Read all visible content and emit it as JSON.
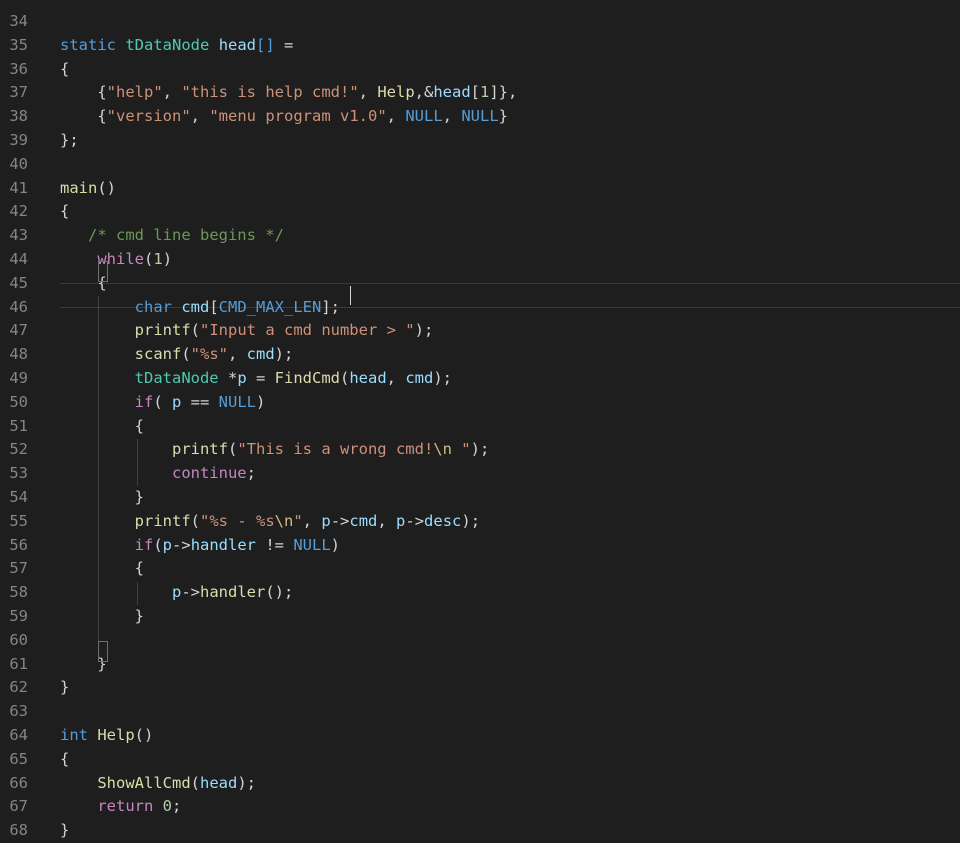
{
  "editor": {
    "theme_colors": {
      "background": "#1e1e1e",
      "line_number": "#858585",
      "keyword": "#569cd6",
      "control": "#c586c0",
      "type": "#4ec9b0",
      "variable": "#9cdcfe",
      "function": "#dcdcaa",
      "string": "#ce9178",
      "number": "#b5cea8",
      "comment": "#6a9955"
    },
    "lines": [
      {
        "n": "34",
        "tokens": []
      },
      {
        "n": "35",
        "tokens": [
          [
            "kw",
            "static"
          ],
          [
            "plain",
            " "
          ],
          [
            "type",
            "tDataNode"
          ],
          [
            "plain",
            " "
          ],
          [
            "var",
            "head"
          ],
          [
            "kw",
            "[]"
          ],
          [
            "plain",
            " ="
          ]
        ]
      },
      {
        "n": "36",
        "tokens": [
          [
            "pun",
            "{"
          ]
        ]
      },
      {
        "n": "37",
        "tokens": [
          [
            "plain",
            "    "
          ],
          [
            "pun",
            "{"
          ],
          [
            "str",
            "\"help\""
          ],
          [
            "pun",
            ", "
          ],
          [
            "str",
            "\"this is help cmd!\""
          ],
          [
            "pun",
            ", "
          ],
          [
            "fn",
            "Help"
          ],
          [
            "pun",
            ",&"
          ],
          [
            "var",
            "head"
          ],
          [
            "pun",
            "["
          ],
          [
            "num",
            "1"
          ],
          [
            "pun",
            "]},"
          ]
        ]
      },
      {
        "n": "38",
        "tokens": [
          [
            "plain",
            "    "
          ],
          [
            "pun",
            "{"
          ],
          [
            "str",
            "\"version\""
          ],
          [
            "pun",
            ", "
          ],
          [
            "str",
            "\"menu program v1.0\""
          ],
          [
            "pun",
            ", "
          ],
          [
            "mac",
            "NULL"
          ],
          [
            "pun",
            ", "
          ],
          [
            "mac",
            "NULL"
          ],
          [
            "pun",
            "}"
          ]
        ]
      },
      {
        "n": "39",
        "tokens": [
          [
            "pun",
            "};"
          ]
        ]
      },
      {
        "n": "40",
        "tokens": []
      },
      {
        "n": "41",
        "tokens": [
          [
            "fn",
            "main"
          ],
          [
            "pun",
            "()"
          ]
        ]
      },
      {
        "n": "42",
        "tokens": [
          [
            "pun",
            "{"
          ]
        ]
      },
      {
        "n": "43",
        "tokens": [
          [
            "plain",
            "   "
          ],
          [
            "com",
            "/* cmd line begins */"
          ]
        ]
      },
      {
        "n": "44",
        "tokens": [
          [
            "plain",
            "    "
          ],
          [
            "ctl",
            "while"
          ],
          [
            "pun",
            "("
          ],
          [
            "num",
            "1"
          ],
          [
            "pun",
            ")"
          ]
        ]
      },
      {
        "n": "45",
        "tokens": [
          [
            "plain",
            "    "
          ],
          [
            "pun",
            "{"
          ]
        ]
      },
      {
        "n": "46",
        "tokens": [
          [
            "plain",
            "        "
          ],
          [
            "kw",
            "char"
          ],
          [
            "plain",
            " "
          ],
          [
            "var",
            "cmd"
          ],
          [
            "pun",
            "["
          ],
          [
            "mac",
            "CMD_MAX_LEN"
          ],
          [
            "pun",
            "];"
          ]
        ]
      },
      {
        "n": "47",
        "tokens": [
          [
            "plain",
            "        "
          ],
          [
            "fn",
            "printf"
          ],
          [
            "pun",
            "("
          ],
          [
            "str",
            "\"Input a cmd number > \""
          ],
          [
            "pun",
            ");"
          ]
        ]
      },
      {
        "n": "48",
        "tokens": [
          [
            "plain",
            "        "
          ],
          [
            "fn",
            "scanf"
          ],
          [
            "pun",
            "("
          ],
          [
            "str",
            "\"%s\""
          ],
          [
            "pun",
            ", "
          ],
          [
            "var",
            "cmd"
          ],
          [
            "pun",
            ");"
          ]
        ]
      },
      {
        "n": "49",
        "tokens": [
          [
            "plain",
            "        "
          ],
          [
            "type",
            "tDataNode"
          ],
          [
            "plain",
            " *"
          ],
          [
            "var",
            "p"
          ],
          [
            "plain",
            " = "
          ],
          [
            "fn",
            "FindCmd"
          ],
          [
            "pun",
            "("
          ],
          [
            "var",
            "head"
          ],
          [
            "pun",
            ", "
          ],
          [
            "var",
            "cmd"
          ],
          [
            "pun",
            ");"
          ]
        ]
      },
      {
        "n": "50",
        "tokens": [
          [
            "plain",
            "        "
          ],
          [
            "ctl",
            "if"
          ],
          [
            "pun",
            "( "
          ],
          [
            "var",
            "p"
          ],
          [
            "plain",
            " == "
          ],
          [
            "mac",
            "NULL"
          ],
          [
            "pun",
            ")"
          ]
        ]
      },
      {
        "n": "51",
        "tokens": [
          [
            "plain",
            "        "
          ],
          [
            "pun",
            "{"
          ]
        ]
      },
      {
        "n": "52",
        "tokens": [
          [
            "plain",
            "            "
          ],
          [
            "fn",
            "printf"
          ],
          [
            "pun",
            "("
          ],
          [
            "str",
            "\"This is a wrong cmd!"
          ],
          [
            "esc",
            "\\n"
          ],
          [
            "str",
            " \""
          ],
          [
            "pun",
            ");"
          ]
        ]
      },
      {
        "n": "53",
        "tokens": [
          [
            "plain",
            "            "
          ],
          [
            "ctl",
            "continue"
          ],
          [
            "pun",
            ";"
          ]
        ]
      },
      {
        "n": "54",
        "tokens": [
          [
            "plain",
            "        "
          ],
          [
            "pun",
            "}"
          ]
        ]
      },
      {
        "n": "55",
        "tokens": [
          [
            "plain",
            "        "
          ],
          [
            "fn",
            "printf"
          ],
          [
            "pun",
            "("
          ],
          [
            "str",
            "\"%s - %s"
          ],
          [
            "esc",
            "\\n"
          ],
          [
            "str",
            "\""
          ],
          [
            "pun",
            ", "
          ],
          [
            "var",
            "p"
          ],
          [
            "pun",
            "->"
          ],
          [
            "var",
            "cmd"
          ],
          [
            "pun",
            ", "
          ],
          [
            "var",
            "p"
          ],
          [
            "pun",
            "->"
          ],
          [
            "var",
            "desc"
          ],
          [
            "pun",
            ");"
          ]
        ]
      },
      {
        "n": "56",
        "tokens": [
          [
            "plain",
            "        "
          ],
          [
            "ctl",
            "if"
          ],
          [
            "pun",
            "("
          ],
          [
            "var",
            "p"
          ],
          [
            "pun",
            "->"
          ],
          [
            "var",
            "handler"
          ],
          [
            "plain",
            " != "
          ],
          [
            "mac",
            "NULL"
          ],
          [
            "pun",
            ")"
          ]
        ]
      },
      {
        "n": "57",
        "tokens": [
          [
            "plain",
            "        "
          ],
          [
            "pun",
            "{"
          ]
        ]
      },
      {
        "n": "58",
        "tokens": [
          [
            "plain",
            "            "
          ],
          [
            "var",
            "p"
          ],
          [
            "pun",
            "->"
          ],
          [
            "fn",
            "handler"
          ],
          [
            "pun",
            "();"
          ]
        ]
      },
      {
        "n": "59",
        "tokens": [
          [
            "plain",
            "        "
          ],
          [
            "pun",
            "}"
          ]
        ]
      },
      {
        "n": "60",
        "tokens": []
      },
      {
        "n": "61",
        "tokens": [
          [
            "plain",
            "    "
          ],
          [
            "pun",
            "}"
          ]
        ]
      },
      {
        "n": "62",
        "tokens": [
          [
            "pun",
            "}"
          ]
        ]
      },
      {
        "n": "63",
        "tokens": []
      },
      {
        "n": "64",
        "tokens": [
          [
            "kw",
            "int"
          ],
          [
            "plain",
            " "
          ],
          [
            "fn",
            "Help"
          ],
          [
            "pun",
            "()"
          ]
        ]
      },
      {
        "n": "65",
        "tokens": [
          [
            "pun",
            "{"
          ]
        ]
      },
      {
        "n": "66",
        "tokens": [
          [
            "plain",
            "    "
          ],
          [
            "fn",
            "ShowAllCmd"
          ],
          [
            "pun",
            "("
          ],
          [
            "var",
            "head"
          ],
          [
            "pun",
            ");"
          ]
        ]
      },
      {
        "n": "67",
        "tokens": [
          [
            "plain",
            "    "
          ],
          [
            "ctl",
            "return"
          ],
          [
            "plain",
            " "
          ],
          [
            "num",
            "0"
          ],
          [
            "pun",
            ";"
          ]
        ]
      },
      {
        "n": "68",
        "tokens": [
          [
            "pun",
            "}"
          ]
        ]
      }
    ]
  }
}
